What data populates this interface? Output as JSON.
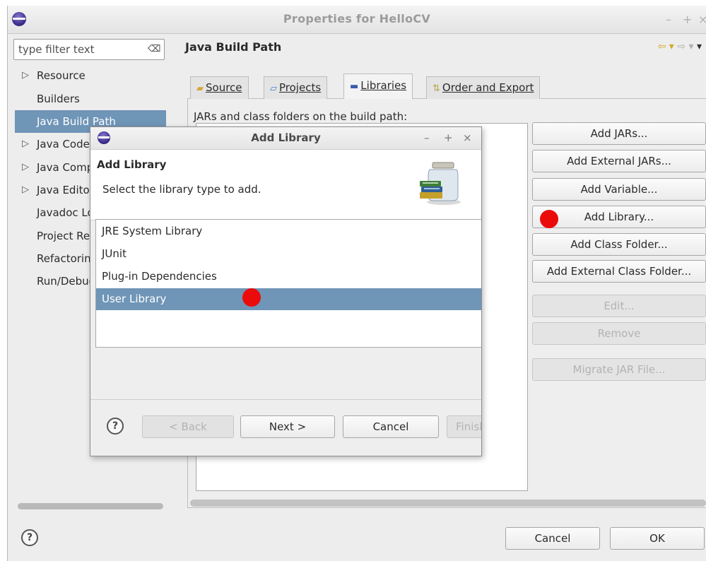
{
  "window": {
    "title": "Properties for HelloCV",
    "controls": [
      "–",
      "+",
      "×"
    ]
  },
  "nav": {
    "filter_placeholder": "type filter text",
    "items": [
      {
        "label": "Resource",
        "expandable": true
      },
      {
        "label": "Builders",
        "expandable": false
      },
      {
        "label": "Java Build Path",
        "expandable": false,
        "selected": true
      },
      {
        "label": "Java Code Style",
        "expandable": true
      },
      {
        "label": "Java Compiler",
        "expandable": true
      },
      {
        "label": "Java Editor",
        "expandable": true
      },
      {
        "label": "Javadoc Location",
        "expandable": false
      },
      {
        "label": "Project References",
        "expandable": false
      },
      {
        "label": "Refactoring History",
        "expandable": false
      },
      {
        "label": "Run/Debug Settings",
        "expandable": false
      }
    ]
  },
  "page": {
    "title": "Java Build Path",
    "tabs": [
      {
        "label": "Source",
        "mnemonic_index": 0,
        "icon": "source-folder-icon"
      },
      {
        "label": "Projects",
        "mnemonic_index": 0,
        "icon": "project-icon"
      },
      {
        "label": "Libraries",
        "mnemonic_index": 0,
        "icon": "libraries-icon",
        "active": true
      },
      {
        "label": "Order and Export",
        "mnemonic_index": 0,
        "icon": "order-export-icon"
      }
    ],
    "list_label": "JARs and class folders on the build path:",
    "side_buttons": [
      {
        "label": "Add JARs...",
        "enabled": true
      },
      {
        "label": "Add External JARs...",
        "enabled": true
      },
      {
        "label": "Add Variable...",
        "enabled": true
      },
      {
        "label": "Add Library...",
        "enabled": true
      },
      {
        "label": "Add Class Folder...",
        "enabled": true
      },
      {
        "label": "Add External Class Folder...",
        "enabled": true
      },
      {
        "label": "Edit...",
        "enabled": false
      },
      {
        "label": "Remove",
        "enabled": false
      },
      {
        "label": "Migrate JAR File...",
        "enabled": false
      }
    ]
  },
  "footer": {
    "help": "?",
    "cancel": "Cancel",
    "ok": "OK"
  },
  "dialog": {
    "title": "Add Library",
    "controls": [
      "–",
      "+",
      "×"
    ],
    "header_title": "Add Library",
    "header_desc": "Select the library type to add.",
    "libraries": [
      {
        "label": "JRE System Library",
        "selected": false
      },
      {
        "label": "JUnit",
        "selected": false
      },
      {
        "label": "Plug-in Dependencies",
        "selected": false
      },
      {
        "label": "User Library",
        "selected": true
      }
    ],
    "help": "?",
    "back": "< Back",
    "next": "Next >",
    "cancel": "Cancel",
    "finish": "Finish"
  },
  "colors": {
    "selection": "#6f95b7",
    "annotation_dot": "#ec0b0b"
  }
}
